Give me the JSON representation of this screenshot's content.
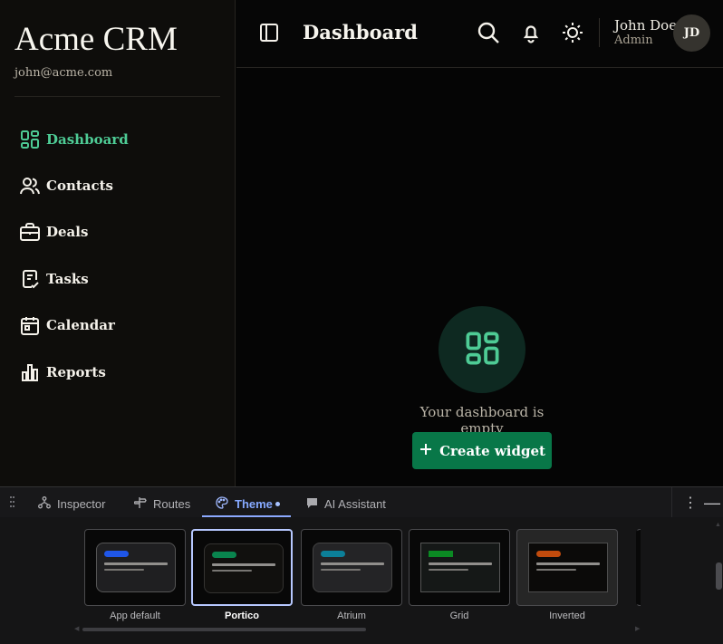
{
  "sidebar": {
    "brand": "Acme CRM",
    "email": "john@acme.com",
    "items": [
      {
        "label": "Dashboard",
        "icon": "dashboard-icon",
        "active": true
      },
      {
        "label": "Contacts",
        "icon": "contacts-icon",
        "active": false
      },
      {
        "label": "Deals",
        "icon": "briefcase-icon",
        "active": false
      },
      {
        "label": "Tasks",
        "icon": "tasks-icon",
        "active": false
      },
      {
        "label": "Calendar",
        "icon": "calendar-icon",
        "active": false
      },
      {
        "label": "Reports",
        "icon": "reports-icon",
        "active": false
      }
    ]
  },
  "header": {
    "title": "Dashboard",
    "user": {
      "name": "John Doe",
      "role": "Admin",
      "initials": "JD"
    },
    "icons": [
      "sidebar-toggle-icon",
      "search-icon",
      "bell-icon",
      "sun-icon"
    ]
  },
  "dashboard": {
    "empty_text": "Your dashboard is empty",
    "create_label": "Create widget",
    "empty_icon": "dashboard-icon"
  },
  "devtools": {
    "tabs": [
      {
        "label": "Inspector",
        "icon": "hierarchy-icon"
      },
      {
        "label": "Routes",
        "icon": "route-icon"
      },
      {
        "label": "Theme",
        "icon": "palette-icon",
        "active": true
      },
      {
        "label": "AI Assistant",
        "icon": "chat-icon"
      }
    ],
    "themes": [
      {
        "label": "App default",
        "accent": "#1f56e8",
        "selected": false
      },
      {
        "label": "Portico",
        "accent": "#09844e",
        "selected": true
      },
      {
        "label": "Atrium",
        "accent": "#0c7f98",
        "selected": false
      },
      {
        "label": "Grid",
        "accent": "#0b8a23",
        "selected": false
      },
      {
        "label": "Inverted",
        "accent": "#c14b0d",
        "selected": false
      }
    ]
  },
  "colors": {
    "accent": "#4ecb95",
    "button": "#087748",
    "theme_tab": "#86a9ff"
  }
}
